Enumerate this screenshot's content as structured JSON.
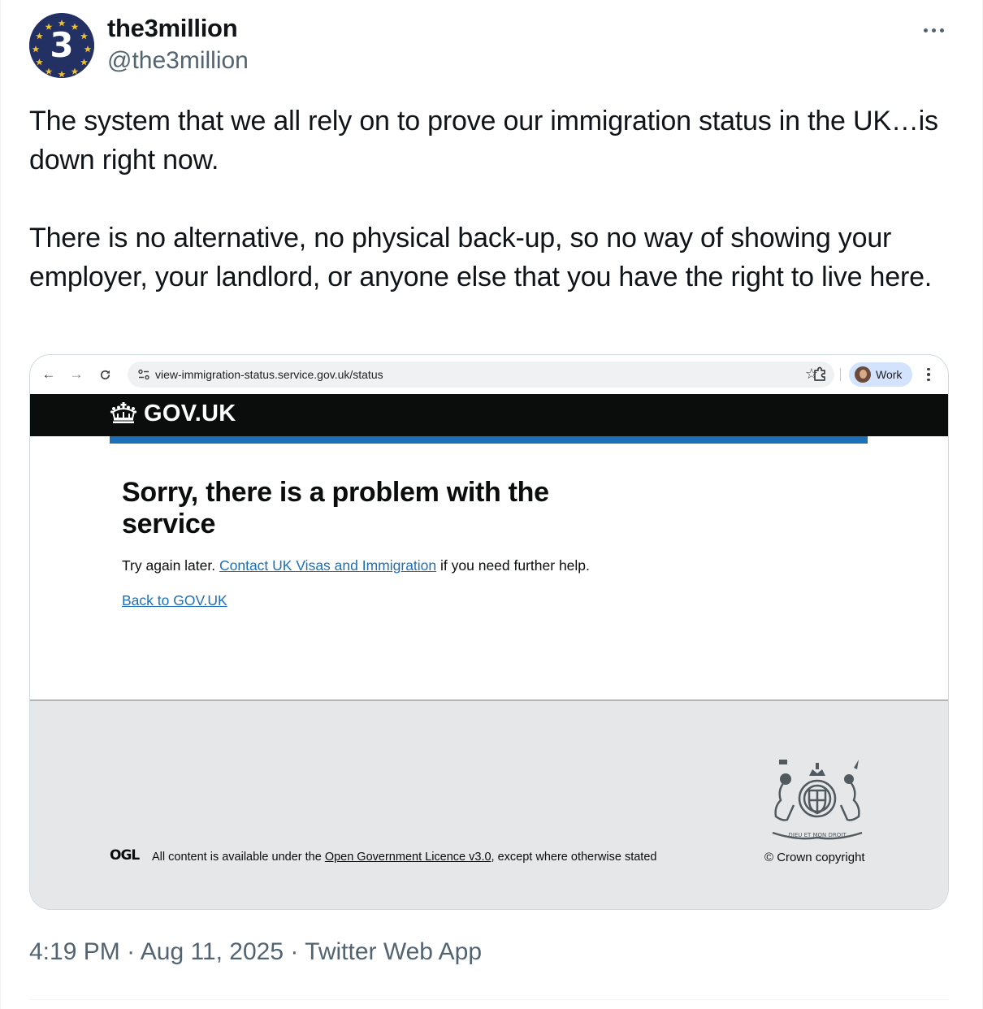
{
  "account": {
    "display_name": "the3million",
    "handle": "@the3million",
    "avatar_icon": "eu-stars-3-logo-icon",
    "avatar_number": "3",
    "avatar_color": "#223063"
  },
  "tweet": {
    "paragraph_1": "The system that we all rely on to prove our immigration status in the UK…is down right now.",
    "paragraph_2": "There is no alternative, no physical back-up, so no way of showing your employer, your landlord, or anyone else that you have the right to live here.",
    "time": "4:19 PM",
    "date": "Aug 11, 2025",
    "client": "Twitter Web App",
    "separator": "·"
  },
  "screenshot": {
    "browser": {
      "url": "view-immigration-status.service.gov.uk/status",
      "profile_label": "Work",
      "profile_chip_color": "#d3e3fd"
    },
    "govuk": {
      "logo_text": "GOV.UK",
      "header_color": "#0b0c0c",
      "accent_color": "#1d70b8",
      "heading": "Sorry, there is a problem with the service",
      "body_prefix": "Try again later.",
      "body_link": "Contact UK Visas and Immigration",
      "body_suffix": "if you need further help.",
      "back_link": "Back to GOV.UK",
      "footer": {
        "ogl_label": "OGL",
        "licence_prefix": "All content is available under the",
        "licence_link": "Open Government Licence v3.0",
        "licence_suffix": ", except where otherwise stated",
        "copyright": "© Crown copyright",
        "arms_motto": "DIEU ET MON DROIT",
        "background_color": "#e6e7e9"
      }
    }
  }
}
